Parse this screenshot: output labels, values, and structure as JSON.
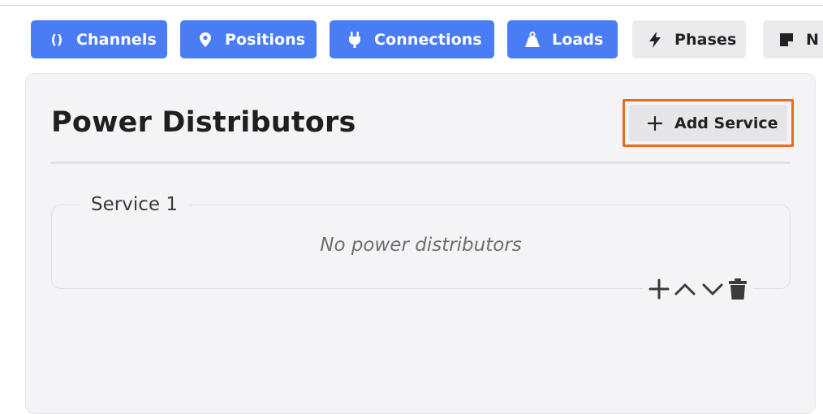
{
  "tabs": [
    {
      "label": "Channels",
      "icon": "parentheses-icon",
      "style": "primary"
    },
    {
      "label": "Positions",
      "icon": "map-pin-icon",
      "style": "primary"
    },
    {
      "label": "Connections",
      "icon": "plug-icon",
      "style": "primary"
    },
    {
      "label": "Loads",
      "icon": "weight-icon",
      "style": "primary"
    },
    {
      "label": "Phases",
      "icon": "lightning-bolt-icon",
      "style": "secondary"
    },
    {
      "label": "N",
      "icon": "note-icon",
      "style": "secondary"
    }
  ],
  "panel": {
    "title": "Power Distributors",
    "add_service_label": "Add Service"
  },
  "services": [
    {
      "name": "Service 1",
      "empty_text": "No power distributors",
      "actions": [
        "plus-icon",
        "chevron-up-icon",
        "chevron-down-icon",
        "trash-icon"
      ]
    }
  ],
  "colors": {
    "primary_tab": "#4a7cf4",
    "secondary_tab": "#ebebed",
    "highlight_outline": "#ec6a1e",
    "panel_background": "#f4f4f6"
  }
}
